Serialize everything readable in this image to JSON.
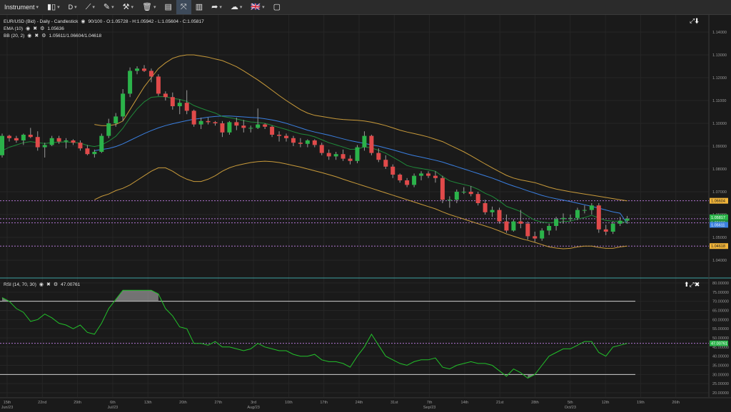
{
  "toolbar": {
    "instrument_label": "Instrument",
    "interval_label": "D",
    "items": [
      {
        "name": "instrument-menu",
        "icon": "",
        "label": "Instrument",
        "caret": true
      },
      {
        "name": "chart-type-menu",
        "icon": "▮▯",
        "label": "",
        "caret": true
      },
      {
        "name": "interval-menu",
        "icon": "",
        "label": "D",
        "caret": true
      },
      {
        "name": "draw-line-menu",
        "icon": "⟋",
        "label": "",
        "caret": true
      },
      {
        "name": "pencil-menu",
        "icon": "✎",
        "label": "",
        "caret": true
      },
      {
        "name": "tools-menu",
        "icon": "⚒",
        "label": "",
        "caret": true
      },
      {
        "name": "delete-menu",
        "icon": "🗑",
        "label": "",
        "caret": true
      },
      {
        "name": "layout-button",
        "icon": "▤",
        "label": "",
        "caret": false
      },
      {
        "name": "crosshair-button",
        "icon": "⤧",
        "label": "",
        "caret": false
      },
      {
        "name": "indicators-button",
        "icon": "▥",
        "label": "",
        "caret": false
      },
      {
        "name": "share-menu",
        "icon": "➦",
        "label": "",
        "caret": true
      },
      {
        "name": "theme-menu",
        "icon": "☁",
        "label": "",
        "caret": true
      },
      {
        "name": "language-menu",
        "icon": "🇬🇧",
        "label": "",
        "caret": true
      },
      {
        "name": "snapshot-button",
        "icon": "▢",
        "label": "",
        "caret": false
      }
    ]
  },
  "legend": {
    "main": "EUR/USD (Bid) - Daily - Candlestick",
    "ohlc": "90/100 - O:1.05728 - H:1.05942 - L:1.05604 - C:1.05817",
    "ema_label": "EMA (10)",
    "ema_value": "1.05636",
    "bb_label": "BB (20, 2)",
    "bb_value": "1.05611/1.06604/1.04618",
    "rsi_label": "RSI (14, 70, 30)",
    "rsi_value": "47.00761"
  },
  "price_axis": {
    "ticks": [
      "1.14000",
      "1.13000",
      "1.12000",
      "1.11000",
      "1.10000",
      "1.09000",
      "1.08000",
      "1.07000",
      "1.06000",
      "1.05000",
      "1.04000"
    ],
    "markers": [
      {
        "value": "1.06604",
        "color": "#f0b43a",
        "text_color": "#1a1a1a"
      },
      {
        "value": "1.05817",
        "color": "#2bb34a",
        "text_color": "#ffffff"
      },
      {
        "value": "1.05636",
        "color": "#1f8a3a",
        "text_color": "#ffffff"
      },
      {
        "value": "1.05611",
        "color": "#3a7fe0",
        "text_color": "#ffffff"
      },
      {
        "value": "1.04618",
        "color": "#f0b43a",
        "text_color": "#1a1a1a"
      }
    ]
  },
  "rsi_axis": {
    "ticks": [
      "80.00000",
      "75.00000",
      "70.00000",
      "65.00000",
      "60.00000",
      "55.00000",
      "50.00000",
      "45.00000",
      "40.00000",
      "35.00000",
      "30.00000",
      "25.00000",
      "20.00000"
    ],
    "marker": {
      "value": "47.00761",
      "color": "#2bb34a"
    }
  },
  "time_axis": {
    "ticks": [
      {
        "label": "15th",
        "sub": "Jun/23"
      },
      {
        "label": "22nd",
        "sub": ""
      },
      {
        "label": "29th",
        "sub": ""
      },
      {
        "label": "6th",
        "sub": "Jul/23"
      },
      {
        "label": "13th",
        "sub": ""
      },
      {
        "label": "20th",
        "sub": ""
      },
      {
        "label": "27th",
        "sub": ""
      },
      {
        "label": "3rd",
        "sub": "Aug/23"
      },
      {
        "label": "10th",
        "sub": ""
      },
      {
        "label": "17th",
        "sub": ""
      },
      {
        "label": "24th",
        "sub": ""
      },
      {
        "label": "31st",
        "sub": ""
      },
      {
        "label": "7th",
        "sub": "Sep/23"
      },
      {
        "label": "14th",
        "sub": ""
      },
      {
        "label": "21st",
        "sub": ""
      },
      {
        "label": "28th",
        "sub": ""
      },
      {
        "label": "5th",
        "sub": "Oct/23"
      },
      {
        "label": "12th",
        "sub": ""
      },
      {
        "label": "19th",
        "sub": ""
      },
      {
        "label": "26th",
        "sub": ""
      }
    ]
  },
  "colors": {
    "up": "#2bb34a",
    "down": "#e04a4a",
    "ema": "#1f8a3a",
    "bb_mid": "#3a7fe0",
    "bb_band": "#c89a3a",
    "rsi": "#22c02a",
    "dashed": "#b074d0",
    "grid": "#262626",
    "bg": "#1a1a1a"
  },
  "chart_data": {
    "type": "candlestick",
    "title": "EUR/USD (Bid) - Daily - Candlestick",
    "ylim": [
      1.035,
      1.145
    ],
    "candles": [
      [
        1.086,
        1.0955,
        1.085,
        1.0945
      ],
      [
        1.0945,
        1.095,
        1.092,
        1.0935
      ],
      [
        1.0935,
        1.0945,
        1.0915,
        1.0925
      ],
      [
        1.0925,
        1.0955,
        1.0905,
        1.095
      ],
      [
        1.095,
        1.098,
        1.0935,
        1.094
      ],
      [
        1.094,
        1.0965,
        1.088,
        1.0895
      ],
      [
        1.0895,
        1.0915,
        1.085,
        1.0905
      ],
      [
        1.0905,
        1.0945,
        1.09,
        1.0935
      ],
      [
        1.0935,
        1.0945,
        1.091,
        1.092
      ],
      [
        1.092,
        1.0935,
        1.089,
        1.0925
      ],
      [
        1.0925,
        1.093,
        1.0905,
        1.0915
      ],
      [
        1.0915,
        1.0925,
        1.088,
        1.089
      ],
      [
        1.089,
        1.0905,
        1.086,
        1.0865
      ],
      [
        1.0865,
        1.0885,
        1.085,
        1.0875
      ],
      [
        1.0875,
        1.0955,
        1.087,
        1.0945
      ],
      [
        1.0945,
        1.102,
        1.0935,
        1.1
      ],
      [
        1.1,
        1.1045,
        1.0985,
        1.103
      ],
      [
        1.103,
        1.115,
        1.101,
        1.113
      ],
      [
        1.113,
        1.1245,
        1.1115,
        1.123
      ],
      [
        1.123,
        1.125,
        1.1215,
        1.124
      ],
      [
        1.124,
        1.1255,
        1.1225,
        1.123
      ],
      [
        1.123,
        1.124,
        1.118,
        1.1205
      ],
      [
        1.1205,
        1.1215,
        1.112,
        1.113
      ],
      [
        1.113,
        1.114,
        1.11,
        1.1115
      ],
      [
        1.1115,
        1.1135,
        1.106,
        1.1075
      ],
      [
        1.1075,
        1.1105,
        1.104,
        1.109
      ],
      [
        1.109,
        1.1145,
        1.104,
        1.1055
      ],
      [
        1.1055,
        1.106,
        1.0985,
        1.0995
      ],
      [
        1.0995,
        1.1025,
        1.0975,
        1.101
      ],
      [
        1.101,
        1.1025,
        1.0995,
        1.1005
      ],
      [
        1.1005,
        1.101,
        1.099,
        1.1
      ],
      [
        1.1,
        1.101,
        1.094,
        1.096
      ],
      [
        1.096,
        1.101,
        1.095,
        1.1005
      ],
      [
        1.1005,
        1.1025,
        1.097,
        1.099
      ],
      [
        1.099,
        1.1015,
        1.096,
        1.098
      ],
      [
        1.098,
        1.099,
        1.096,
        1.098
      ],
      [
        1.098,
        1.1065,
        1.0975,
        1.0995
      ],
      [
        1.0995,
        1.1,
        1.0975,
        1.0985
      ],
      [
        1.0985,
        1.099,
        1.094,
        1.095
      ],
      [
        1.095,
        1.0965,
        1.092,
        1.0945
      ],
      [
        1.0945,
        1.0955,
        1.092,
        1.0935
      ],
      [
        1.0935,
        1.0945,
        1.09,
        1.0915
      ],
      [
        1.0915,
        1.0935,
        1.0895,
        1.091
      ],
      [
        1.091,
        1.093,
        1.0895,
        1.0925
      ],
      [
        1.0925,
        1.093,
        1.0895,
        1.0905
      ],
      [
        1.0905,
        1.0915,
        1.086,
        1.087
      ],
      [
        1.087,
        1.0885,
        1.084,
        1.0855
      ],
      [
        1.0855,
        1.0875,
        1.084,
        1.0865
      ],
      [
        1.0865,
        1.0885,
        1.0835,
        1.0845
      ],
      [
        1.0845,
        1.086,
        1.082,
        1.0835
      ],
      [
        1.0835,
        1.0905,
        1.0825,
        1.0895
      ],
      [
        1.0895,
        1.0965,
        1.088,
        1.0945
      ],
      [
        1.0945,
        1.095,
        1.086,
        1.087
      ],
      [
        1.087,
        1.089,
        1.083,
        1.084
      ],
      [
        1.084,
        1.086,
        1.08,
        1.081
      ],
      [
        1.081,
        1.082,
        1.076,
        1.0775
      ],
      [
        1.0775,
        1.078,
        1.074,
        1.075
      ],
      [
        1.075,
        1.076,
        1.072,
        1.073
      ],
      [
        1.073,
        1.078,
        1.072,
        1.077
      ],
      [
        1.077,
        1.079,
        1.075,
        1.078
      ],
      [
        1.078,
        1.079,
        1.076,
        1.077
      ],
      [
        1.077,
        1.079,
        1.074,
        1.076
      ],
      [
        1.076,
        1.077,
        1.065,
        1.0665
      ],
      [
        1.0665,
        1.068,
        1.063,
        1.0665
      ],
      [
        1.0665,
        1.071,
        1.065,
        1.07
      ],
      [
        1.07,
        1.072,
        1.069,
        1.07
      ],
      [
        1.07,
        1.0725,
        1.068,
        1.069
      ],
      [
        1.069,
        1.07,
        1.064,
        1.065
      ],
      [
        1.065,
        1.0665,
        1.06,
        1.061
      ],
      [
        1.061,
        1.0635,
        1.059,
        1.062
      ],
      [
        1.062,
        1.063,
        1.056,
        1.057
      ],
      [
        1.057,
        1.06,
        1.052,
        1.053
      ],
      [
        1.053,
        1.058,
        1.0525,
        1.057
      ],
      [
        1.057,
        1.062,
        1.054,
        1.056
      ],
      [
        1.056,
        1.057,
        1.049,
        1.0505
      ],
      [
        1.0505,
        1.0525,
        1.048,
        1.0495
      ],
      [
        1.0495,
        1.054,
        1.0485,
        1.053
      ],
      [
        1.053,
        1.056,
        1.051,
        1.055
      ],
      [
        1.055,
        1.059,
        1.053,
        1.058
      ],
      [
        1.058,
        1.0605,
        1.056,
        1.0585
      ],
      [
        1.0585,
        1.06,
        1.057,
        1.0585
      ],
      [
        1.0585,
        1.063,
        1.0575,
        1.062
      ],
      [
        1.062,
        1.064,
        1.0605,
        1.062
      ],
      [
        1.062,
        1.065,
        1.06,
        1.064
      ],
      [
        1.064,
        1.065,
        1.052,
        1.0535
      ],
      [
        1.0535,
        1.0555,
        1.051,
        1.0525
      ],
      [
        1.0525,
        1.057,
        1.0515,
        1.056
      ],
      [
        1.056,
        1.059,
        1.055,
        1.0573
      ],
      [
        1.0573,
        1.0594,
        1.056,
        1.0582
      ]
    ],
    "ema": [
      1.088,
      1.0895,
      1.0905,
      1.0915,
      1.092,
      1.0915,
      1.0912,
      1.0915,
      1.0918,
      1.0918,
      1.0917,
      1.0913,
      1.0903,
      1.0898,
      1.0905,
      1.0922,
      1.0943,
      1.0978,
      1.1024,
      1.1063,
      1.1094,
      1.1114,
      1.1117,
      1.1117,
      1.1109,
      1.1105,
      1.1096,
      1.1078,
      1.1066,
      1.1055,
      1.1045,
      1.103,
      1.1025,
      1.1019,
      1.1012,
      1.1006,
      1.1004,
      1.1,
      1.0991,
      1.0982,
      1.0973,
      1.0963,
      1.0954,
      1.0949,
      1.0941,
      1.0928,
      1.0915,
      1.0906,
      1.0896,
      1.0886,
      1.0887,
      1.0897,
      1.0892,
      1.0882,
      1.0869,
      1.0852,
      1.0834,
      1.0815,
      1.0807,
      1.0802,
      1.0796,
      1.079,
      1.0767,
      1.0748,
      1.0739,
      1.0732,
      1.0724,
      1.0711,
      1.0693,
      1.068,
      1.066,
      1.0636,
      1.0625,
      1.0613,
      1.0593,
      1.0575,
      1.0567,
      1.0564,
      1.0566,
      1.0569,
      1.0571,
      1.058,
      1.0587,
      1.0597,
      1.0585,
      1.0574,
      1.0571,
      1.0571,
      1.0564
    ],
    "bb_mid": [
      null,
      null,
      null,
      null,
      null,
      null,
      null,
      null,
      null,
      null,
      null,
      null,
      null,
      1.088,
      1.0885,
      1.089,
      1.0898,
      1.091,
      1.0925,
      1.094,
      1.0955,
      1.0968,
      1.098,
      1.099,
      1.0998,
      1.1005,
      1.1012,
      1.1018,
      1.1022,
      1.1027,
      1.103,
      1.1032,
      1.1032,
      1.103,
      1.1028,
      1.1026,
      1.1024,
      1.102,
      1.1015,
      1.1008,
      1.1,
      1.099,
      1.098,
      1.097,
      1.0962,
      1.0955,
      1.0948,
      1.094,
      1.0932,
      1.0924,
      1.0918,
      1.0912,
      1.0906,
      1.09,
      1.0892,
      1.0884,
      1.0875,
      1.0866,
      1.0858,
      1.0852,
      1.0845,
      1.0838,
      1.083,
      1.082,
      1.081,
      1.08,
      1.079,
      1.078,
      1.077,
      1.076,
      1.0748,
      1.0736,
      1.0725,
      1.0715,
      1.0704,
      1.0694,
      1.0684,
      1.0676,
      1.0669,
      1.0663,
      1.0657,
      1.065,
      1.0643,
      1.0636,
      1.0628,
      1.062,
      1.0612,
      1.0606,
      1.0561
    ],
    "bb_up": [
      null,
      null,
      null,
      null,
      null,
      null,
      null,
      null,
      null,
      null,
      null,
      null,
      null,
      1.0995,
      1.099,
      1.099,
      1.0995,
      1.101,
      1.106,
      1.111,
      1.116,
      1.12,
      1.124,
      1.1265,
      1.1285,
      1.1295,
      1.13,
      1.13,
      1.1295,
      1.129,
      1.1282,
      1.1275,
      1.1262,
      1.1248,
      1.123,
      1.121,
      1.119,
      1.1168,
      1.1145,
      1.1122,
      1.11,
      1.108,
      1.106,
      1.1045,
      1.1035,
      1.103,
      1.1025,
      1.102,
      1.1017,
      1.1015,
      1.1013,
      1.101,
      1.1005,
      1.0998,
      1.099,
      1.098,
      1.097,
      1.0962,
      1.0955,
      1.0948,
      1.094,
      1.093,
      1.092,
      1.0905,
      1.089,
      1.0875,
      1.0858,
      1.084,
      1.0822,
      1.0805,
      1.0788,
      1.0772,
      1.076,
      1.0752,
      1.0746,
      1.074,
      1.073,
      1.072,
      1.0712,
      1.0706,
      1.07,
      1.0695,
      1.069,
      1.0685,
      1.068,
      1.0675,
      1.067,
      1.0665,
      1.066
    ],
    "bb_dn": [
      null,
      null,
      null,
      null,
      null,
      null,
      null,
      null,
      null,
      null,
      null,
      null,
      null,
      1.0665,
      1.068,
      1.069,
      1.0705,
      1.0715,
      1.073,
      1.075,
      1.077,
      1.079,
      1.0805,
      1.0805,
      1.079,
      1.077,
      1.0755,
      1.0745,
      1.0745,
      1.0755,
      1.077,
      1.079,
      1.0805,
      1.0815,
      1.0822,
      1.0828,
      1.0832,
      1.0834,
      1.0832,
      1.0828,
      1.0822,
      1.0815,
      1.0808,
      1.08,
      1.0792,
      1.0784,
      1.0775,
      1.0766,
      1.0755,
      1.0745,
      1.0735,
      1.0725,
      1.0715,
      1.0705,
      1.0695,
      1.0685,
      1.0675,
      1.0665,
      1.0655,
      1.0645,
      1.0635,
      1.0625,
      1.0612,
      1.06,
      1.059,
      1.058,
      1.057,
      1.056,
      1.055,
      1.054,
      1.0528,
      1.0515,
      1.0505,
      1.0495,
      1.0487,
      1.0478,
      1.0468,
      1.0458,
      1.0453,
      1.045,
      1.0452,
      1.0458,
      1.0462,
      1.0462,
      1.0456,
      1.0452,
      1.0452,
      1.0458,
      1.0462
    ],
    "rsi": [
      72,
      70,
      66,
      64,
      59,
      60,
      63,
      61,
      58,
      57,
      55,
      57,
      53,
      52,
      58,
      66,
      71,
      76,
      76,
      76,
      76,
      76,
      74,
      66,
      62,
      56,
      55,
      47,
      47,
      46,
      48,
      45,
      45,
      44,
      43,
      44,
      47,
      45,
      44,
      43,
      43,
      41,
      40,
      40,
      41,
      38,
      37,
      37,
      36,
      34,
      40,
      45,
      52,
      46,
      40,
      38,
      36,
      35,
      37,
      38,
      38,
      39,
      34,
      33,
      35,
      36,
      37,
      36,
      36,
      35,
      32,
      29,
      33,
      31,
      28,
      30,
      35,
      40,
      42,
      44,
      44,
      46,
      48,
      48,
      42,
      40,
      45,
      46,
      47
    ],
    "rsi_levels": [
      70,
      30
    ]
  }
}
